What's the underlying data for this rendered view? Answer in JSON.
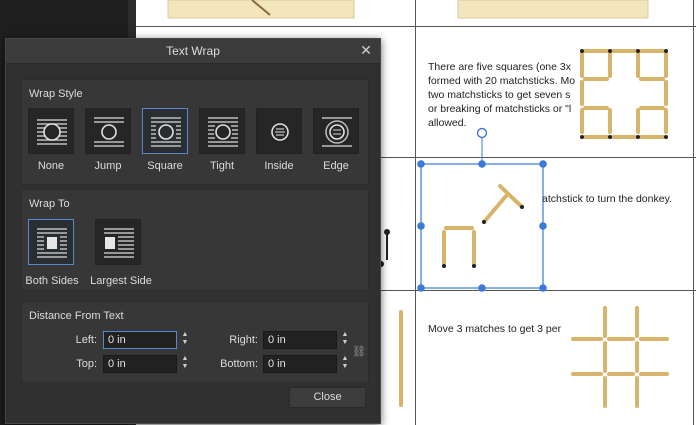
{
  "document": {
    "cell_row2_text": [
      "There are five squares (one 3x",
      "formed with 20 matchsticks. Mo",
      "two matchsticks to get seven s",
      "or breaking of matchsticks or \"l",
      "allowed."
    ],
    "cell_row3_text": "atchstick  to turn the donkey.",
    "cell_row4_text": "Move 3 matches to get 3 per"
  },
  "dialog": {
    "title": "Text Wrap",
    "close_glyph": "✕",
    "wrap_style": {
      "title": "Wrap Style",
      "options": [
        {
          "label": "None",
          "icon": "wrap-none-icon"
        },
        {
          "label": "Jump",
          "icon": "wrap-jump-icon"
        },
        {
          "label": "Square",
          "icon": "wrap-square-icon"
        },
        {
          "label": "Tight",
          "icon": "wrap-tight-icon"
        },
        {
          "label": "Inside",
          "icon": "wrap-inside-icon"
        },
        {
          "label": "Edge",
          "icon": "wrap-edge-icon"
        }
      ],
      "selected": "Square"
    },
    "wrap_to": {
      "title": "Wrap To",
      "options": [
        {
          "label": "Both Sides",
          "icon": "wrap-both-sides-icon"
        },
        {
          "label": "Largest Side",
          "icon": "wrap-largest-side-icon"
        }
      ],
      "selected": "Both Sides"
    },
    "distance": {
      "title": "Distance From Text",
      "left_label": "Left:",
      "left_value": "0 in",
      "right_label": "Right:",
      "right_value": "0 in",
      "top_label": "Top:",
      "top_value": "0 in",
      "bottom_label": "Bottom:",
      "bottom_value": "0 in",
      "stepper_up": "▲",
      "stepper_down": "▼",
      "link_glyph": "⛓"
    },
    "close_label": "Close",
    "colors": {
      "accent": "#5a88c8",
      "panel": "#303030"
    }
  }
}
